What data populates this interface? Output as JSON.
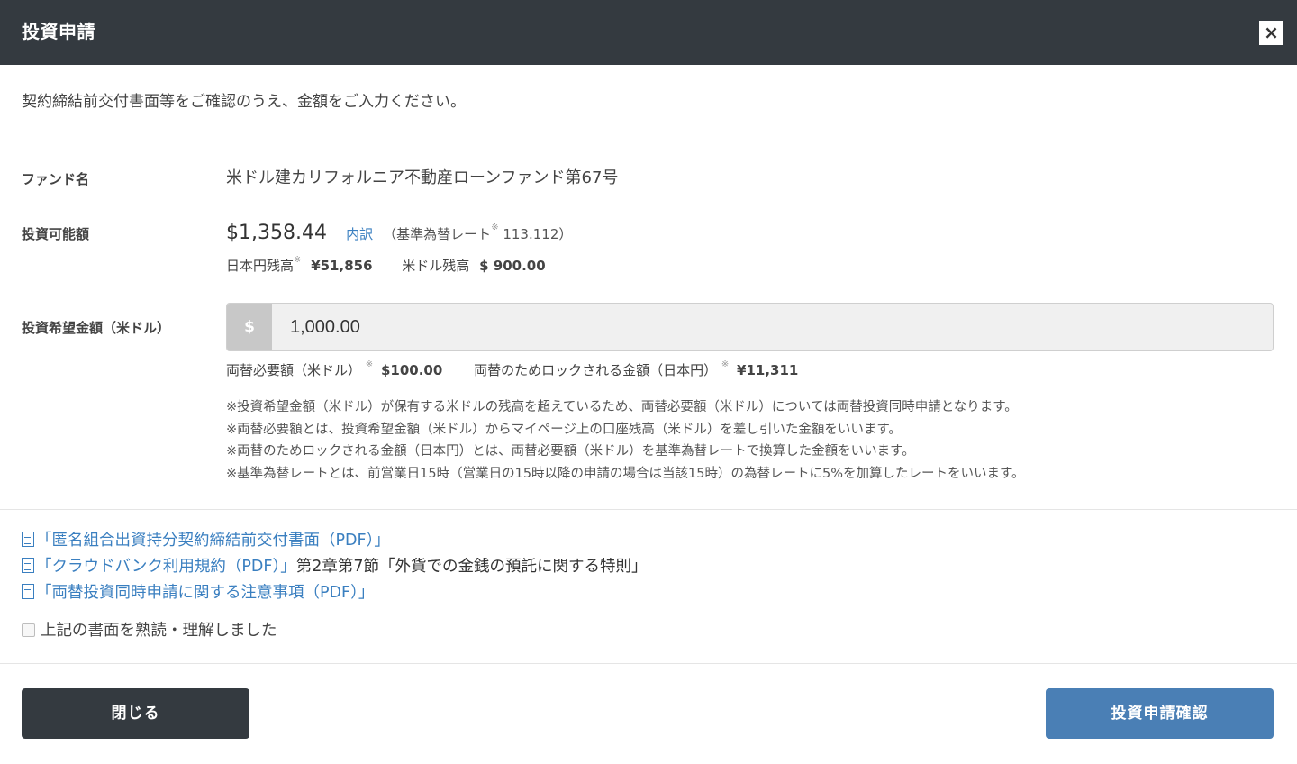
{
  "header": {
    "title": "投資申請",
    "close_glyph": "×"
  },
  "intro": "契約締結前交付書面等をご確認のうえ、金額をご入力ください。",
  "fund": {
    "label": "ファンド名",
    "name": "米ドル建カリフォルニア不動産ローンファンド第67号"
  },
  "available": {
    "label": "投資可能額",
    "amount": "$1,358.44",
    "breakdown_link": "内訳",
    "rate_prefix": "（基準為替レート",
    "note_mark": "※",
    "rate_value": " 113.112）",
    "jpy_balance_label": "日本円残高",
    "jpy_balance_value": "¥51,856",
    "usd_balance_label": "米ドル残高",
    "usd_balance_value": "$ 900.00"
  },
  "desired": {
    "label": "投資希望金額（米ドル）",
    "currency_symbol": "$",
    "value": "1,000.00"
  },
  "exchange": {
    "required_label": "両替必要額（米ドル）",
    "required_value": "$100.00",
    "locked_label": "両替のためロックされる金額（日本円）",
    "locked_value": "¥11,311",
    "note_mark": "※"
  },
  "notes": [
    "※投資希望金額（米ドル）が保有する米ドルの残高を超えているため、両替必要額（米ドル）については両替投資同時申請となります。",
    "※両替必要額とは、投資希望金額（米ドル）からマイページ上の口座残高（米ドル）を差し引いた金額をいいます。",
    "※両替のためロックされる金額（日本円）とは、両替必要額（米ドル）を基準為替レートで換算した金額をいいます。",
    "※基準為替レートとは、前営業日15時（営業日の15時以降の申請の場合は当該15時）の為替レートに5%を加算したレートをいいます。"
  ],
  "documents": [
    {
      "link": "「匿名組合出資持分契約締結前交付書面（PDF）」",
      "suffix": ""
    },
    {
      "link": "「クラウドバンク利用規約（PDF）」",
      "suffix": "第2章第7節「外貨での金銭の預託に関する特則」"
    },
    {
      "link": "「両替投資同時申請に関する注意事項（PDF）」",
      "suffix": ""
    }
  ],
  "confirm_checkbox_label": "上記の書面を熟読・理解しました",
  "buttons": {
    "close": "閉じる",
    "submit": "投資申請確認"
  },
  "colors": {
    "header_bg": "#343a40",
    "link": "#3a7fc0",
    "submit_bg": "#4a7fb5"
  }
}
